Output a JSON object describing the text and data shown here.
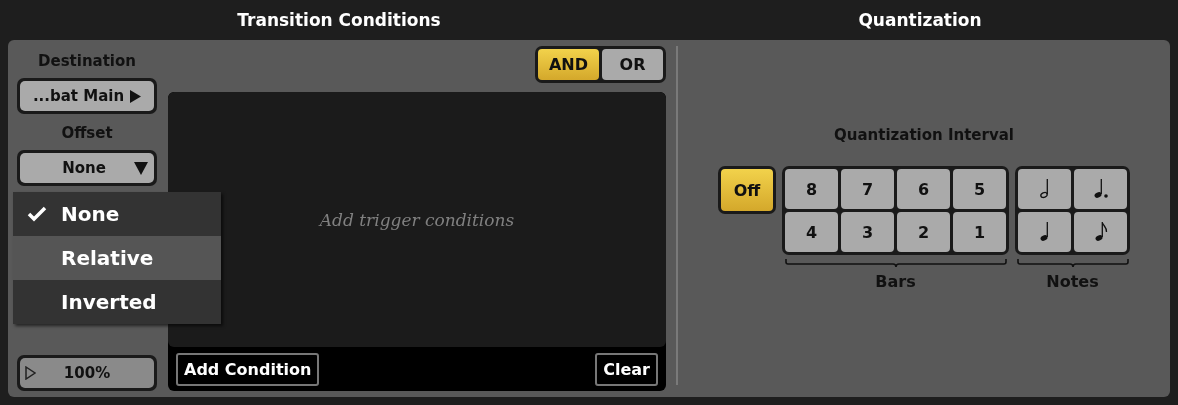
{
  "transition_conditions": {
    "title": "Transition Conditions",
    "destination": {
      "label": "Destination",
      "value": "...bat Main"
    },
    "offset": {
      "label": "Offset",
      "value": "None",
      "menu": [
        {
          "label": "None",
          "checked": true,
          "highlighted": false
        },
        {
          "label": "Relative",
          "checked": false,
          "highlighted": true
        },
        {
          "label": "Inverted",
          "checked": false,
          "highlighted": false
        }
      ]
    },
    "amount": {
      "value": "100%"
    },
    "logic": [
      {
        "label": "AND",
        "selected": true
      },
      {
        "label": "OR",
        "selected": false
      }
    ],
    "conditions": {
      "empty_text": "Add trigger conditions"
    },
    "buttons": [
      "Add Condition",
      "Clear"
    ]
  },
  "quantization": {
    "title": "Quantization",
    "interval_label": "Quantization Interval",
    "off": {
      "label": "Off",
      "selected": true
    },
    "bars": {
      "label": "Bars",
      "items": [
        {
          "label": "8",
          "selected": false
        },
        {
          "label": "7",
          "selected": false
        },
        {
          "label": "6",
          "selected": false
        },
        {
          "label": "5",
          "selected": false
        },
        {
          "label": "4",
          "selected": false
        },
        {
          "label": "3",
          "selected": false
        },
        {
          "label": "2",
          "selected": false
        },
        {
          "label": "1",
          "selected": false
        }
      ]
    },
    "notes": {
      "label": "Notes",
      "items": [
        {
          "kind": "half",
          "selected": false
        },
        {
          "kind": "dotted-quarter",
          "selected": false
        },
        {
          "kind": "quarter",
          "selected": false
        },
        {
          "kind": "eighth",
          "selected": false
        }
      ]
    }
  }
}
